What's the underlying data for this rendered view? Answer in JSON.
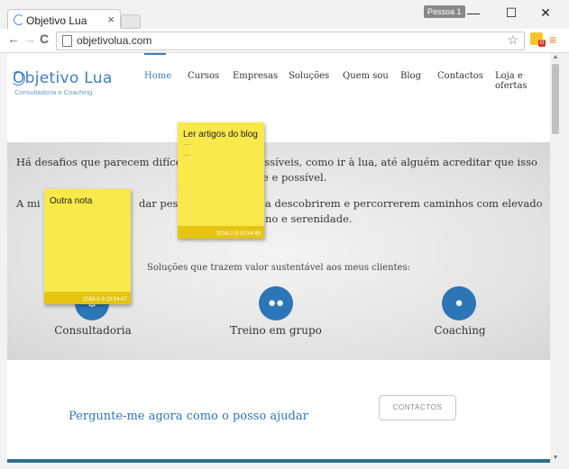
{
  "browser": {
    "tab_title": "Objetivo Lua",
    "tab_close": "×",
    "profile_label": "Pessoa 1",
    "min_glyph": "—",
    "max_glyph": "☐",
    "close_glyph": "✕",
    "back_glyph": "←",
    "forward_glyph": "→",
    "reload_glyph": "C",
    "url": "objetivolua.com",
    "star_glyph": "☆",
    "ext_badge": "0",
    "menu_glyph": "≡"
  },
  "site": {
    "logo_text": "Objetivo Lua",
    "logo_sub": "Consultadoria e Coaching",
    "nav": [
      {
        "label": "Home",
        "active": true
      },
      {
        "label": "Cursos"
      },
      {
        "label": "Empresas"
      },
      {
        "label": "Soluções"
      },
      {
        "label": "Quem sou"
      },
      {
        "label": "Blog"
      },
      {
        "label": "Contactos"
      },
      {
        "label": "Loja e ofertas"
      }
    ],
    "hero_line1a": "Há desafios que parecem difíceis",
    "hero_line1b": "possíveis, como ir à lua, até alguém acreditar que isso é",
    "hero_line2": "nte e possível.",
    "hero_line3a": "A mi",
    "hero_line3b": "dar pesso",
    "hero_line3c": "a descobrirem e percorrerem caminhos com elevado",
    "hero_line4": "no e serenidade.",
    "solucoes_text": "Soluções que trazem valor sustentável aos meus clientes:",
    "services": [
      {
        "label": "Consultadoria",
        "icon": "gears-icon"
      },
      {
        "label": "Treino em grupo",
        "icon": "group-icon"
      },
      {
        "label": "Coaching",
        "icon": "user-icon"
      }
    ],
    "cta_text": "Pergunte-me agora como o posso ajudar",
    "cta_button": "CONTACTOS"
  },
  "notes": [
    {
      "title": "Ler artigos do blog",
      "dots1": "----",
      "dots2": "----",
      "time": "2016-2-9 10:54:45"
    },
    {
      "title": "Outra nota",
      "time": "2016-2-9 10:54:47"
    }
  ],
  "colors": {
    "accent": "#2c75b7",
    "note": "#f9e94a",
    "note_footer": "#e5c512"
  }
}
